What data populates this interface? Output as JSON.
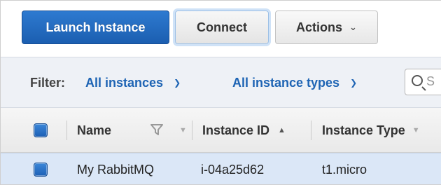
{
  "toolbar": {
    "launch_label": "Launch Instance",
    "connect_label": "Connect",
    "actions_label": "Actions",
    "actions_chevron": "▼"
  },
  "filter": {
    "label": "Filter:",
    "instances": "All instances",
    "types": "All instance types",
    "search_placeholder": "S"
  },
  "table": {
    "columns": [
      "Name",
      "Instance ID",
      "Instance Type"
    ],
    "rows": [
      {
        "name": "My RabbitMQ",
        "instance_id": "i-04a25d62",
        "instance_type": "t1.micro",
        "selected": true
      }
    ]
  },
  "colors": {
    "primary": "#1b5eb0",
    "link": "#1e64b4",
    "selected_row": "#dbe7f7"
  }
}
